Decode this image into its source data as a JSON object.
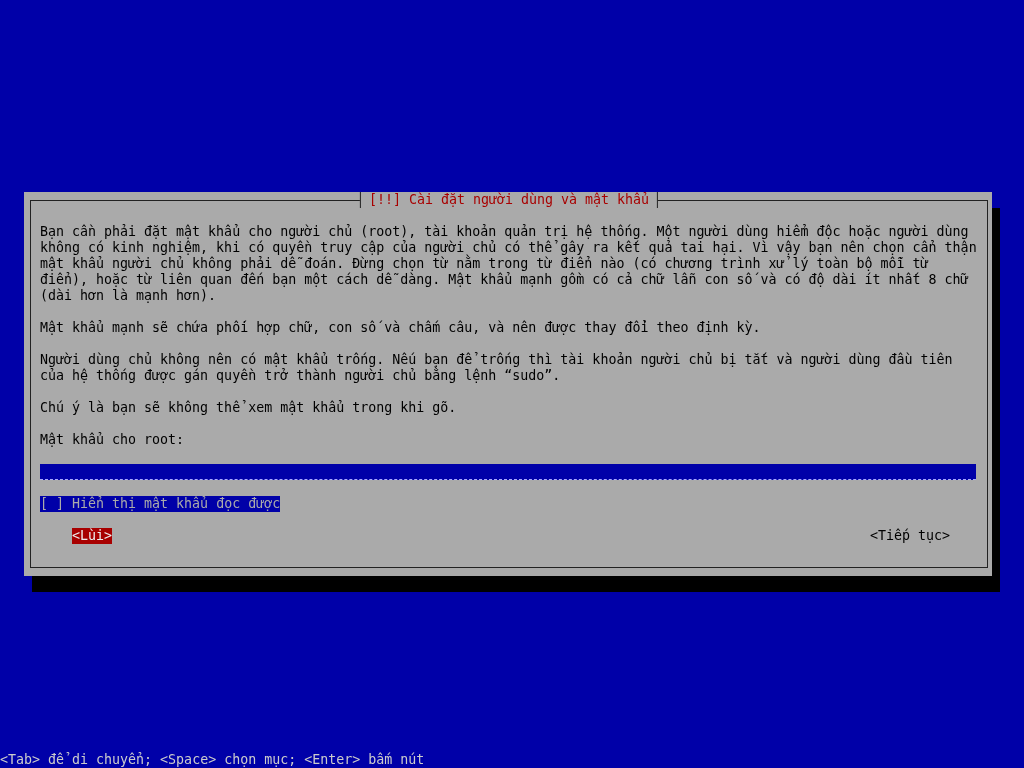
{
  "dialog": {
    "title": "[!!] Cài đặt người dùng và mật khẩu",
    "paragraphs": [
      "Bạn cần phải đặt mật khẩu cho người chủ (root), tài khoản quản trị hệ thống. Một người dùng hiểm độc hoặc người dùng\nkhông có kinh nghiệm, khi có quyền truy cập của người chủ có thể gây ra kết quả tai hại. Vì vậy bạn nên chọn cẩn thận\nmật khẩu người chủ không phải dễ đoán. Đừng chọn từ nằm trong từ điển nào (có chương trình xử lý toàn bộ mỗi từ\nđiển), hoặc từ liên quan đến bạn một cách dễ dàng. Mật khẩu mạnh gồm có cả chữ lẫn con số và có độ dài ít nhất 8 chữ\n(dài hơn là mạnh hơn).",
      "Mật khẩu mạnh sẽ chứa phối hợp chữ, con số và chấm câu, và nên được thay đổi theo định kỳ.",
      "Người dùng chủ không nên có mật khẩu trống. Nếu bạn để trống thì tài khoản người chủ bị tắt và người dùng đầu tiên\ncủa hệ thống được gán quyền trở thành người chủ bằng lệnh “sudo”.",
      "Chú ý là bạn sẽ không thể xem mật khẩu trong khi gõ."
    ],
    "field": {
      "label": "Mật khẩu cho root:"
    },
    "checkbox": {
      "box": "[ ]",
      "label": "Hiển thị mật khẩu đọc được",
      "checked": false,
      "focused": true
    },
    "buttons": [
      {
        "label": "<Lùi>",
        "selected": true
      },
      {
        "label": "<Tiếp tục>",
        "selected": false
      }
    ]
  },
  "status_bar": "<Tab> để di chuyển; <Space> chọn mục; <Enter> bấm nút"
}
